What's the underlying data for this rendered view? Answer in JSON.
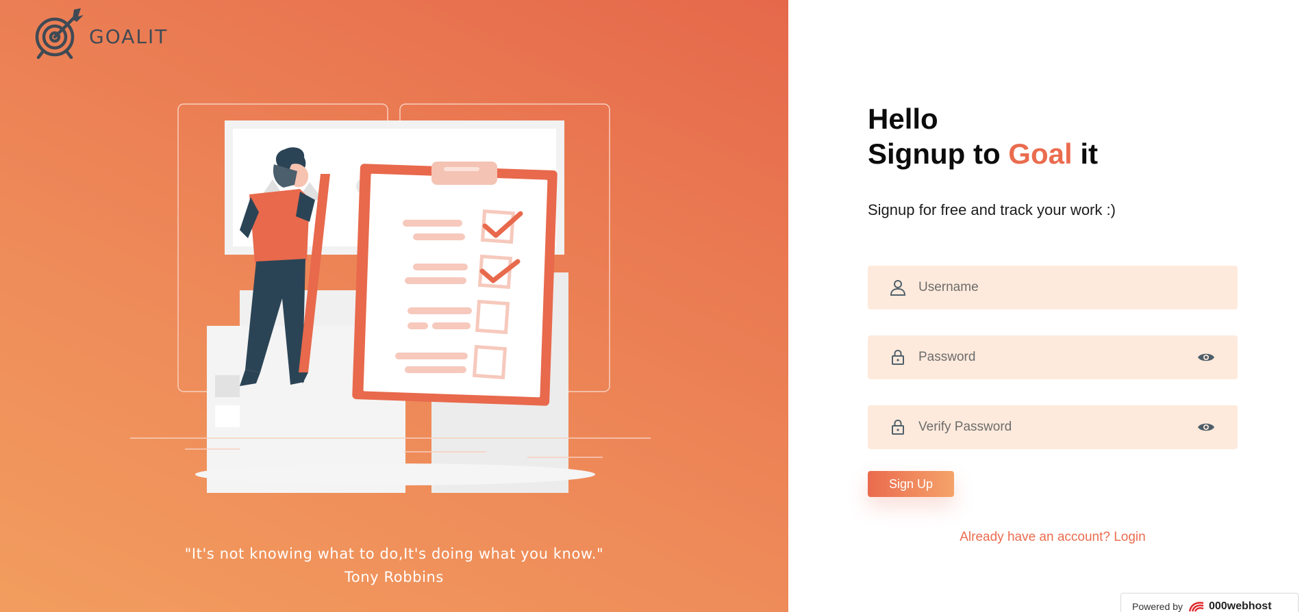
{
  "brand": {
    "name": "GOALIT"
  },
  "quote": {
    "text": "\"It's not knowing what to do,It's doing what you know.\"",
    "author": "Tony Robbins"
  },
  "form": {
    "greeting": "Hello",
    "title_prefix": "Signup to ",
    "title_accent": "Goal",
    "title_suffix": " it",
    "subtitle": "Signup for free and track your work :)",
    "username_placeholder": "Username",
    "password_placeholder": "Password",
    "verify_placeholder": "Verify Password",
    "submit_label": "Sign Up",
    "login_link": "Already have an account? Login"
  },
  "footer": {
    "powered_by": "Powered by",
    "host": "000webhost"
  },
  "colors": {
    "accent": "#ea6c4f",
    "field_bg": "#feeadc",
    "icon": "#4f5f6a"
  },
  "icons": [
    "target-logo-icon",
    "user-icon",
    "lock-icon",
    "eye-icon"
  ]
}
